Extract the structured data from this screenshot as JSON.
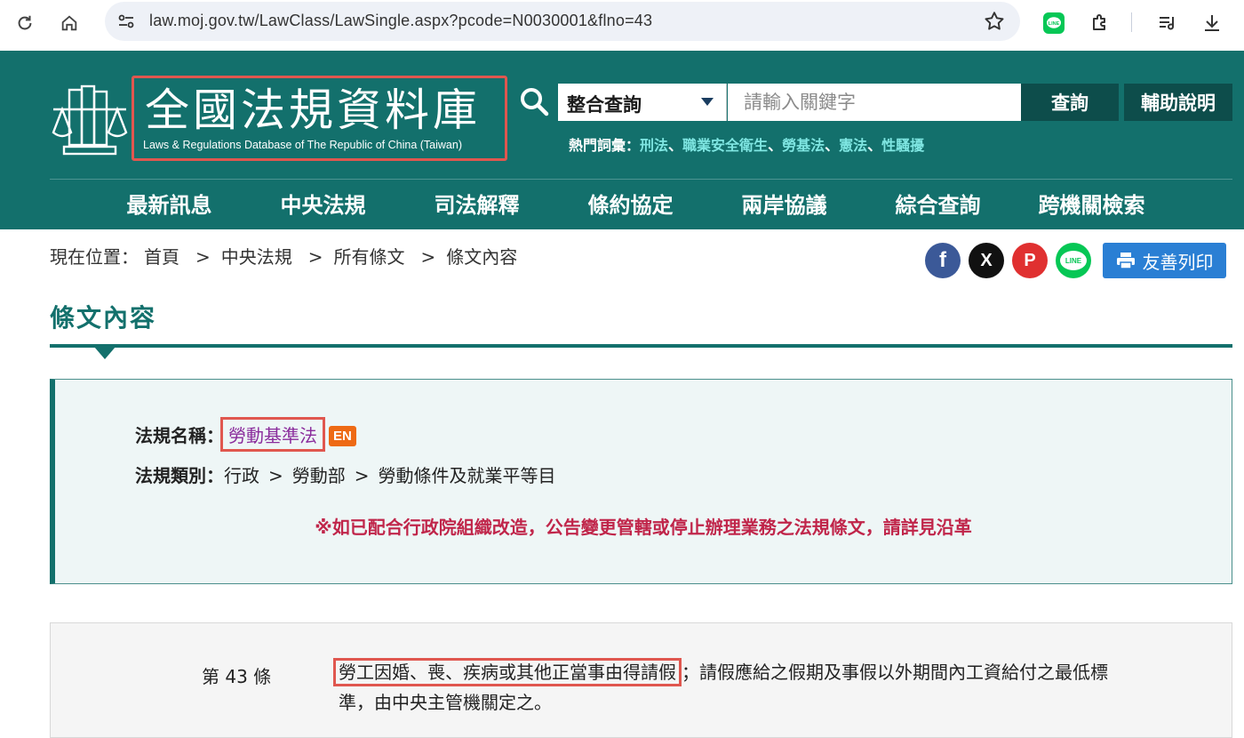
{
  "browser": {
    "url": "law.moj.gov.tw/LawClass/LawSingle.aspx?pcode=N0030001&flno=43"
  },
  "header": {
    "site_title": "全國法規資料庫",
    "site_subtitle": "Laws & Regulations Database of The Republic of China (Taiwan)",
    "search": {
      "select_value": "整合查詢",
      "placeholder": "請輸入關鍵字",
      "query_button": "查詢",
      "help_button": "輔助說明"
    },
    "hot_words": {
      "label": "熱門詞彙：",
      "items": [
        "刑法",
        "職業安全衛生",
        "勞基法",
        "憲法",
        "性騷擾"
      ],
      "separator": "、"
    },
    "nav": [
      "最新訊息",
      "中央法規",
      "司法解釋",
      "條約協定",
      "兩岸協議",
      "綜合查詢",
      "跨機關檢索"
    ],
    "brand_color": "#13706c"
  },
  "breadcrumb": {
    "label": "現在位置：",
    "items": [
      "首頁",
      "中央法規",
      "所有條文",
      "條文內容"
    ],
    "separator": ">"
  },
  "share": {
    "facebook": "f",
    "x": "X",
    "plurk": "P",
    "line": "LINE",
    "print_label": "友善列印"
  },
  "section": {
    "title": "條文內容"
  },
  "info": {
    "law_name_label": "法規名稱：",
    "law_name": "勞動基準法",
    "en_badge": "EN",
    "category_label": "法規類別：",
    "category": [
      "行政",
      "勞動部",
      "勞動條件及就業平等目"
    ],
    "category_separator": ">",
    "notice": "※如已配合行政院組織改造，公告變更管轄或停止辦理業務之法規條文，請詳見沿革"
  },
  "article": {
    "number": "第 43 條",
    "highlighted": "勞工因婚、喪、疾病或其他正當事由得請假",
    "rest": "；請假應給之假期及事假以外期間內工資給付之最低標準，由中央主管機關定之。"
  }
}
